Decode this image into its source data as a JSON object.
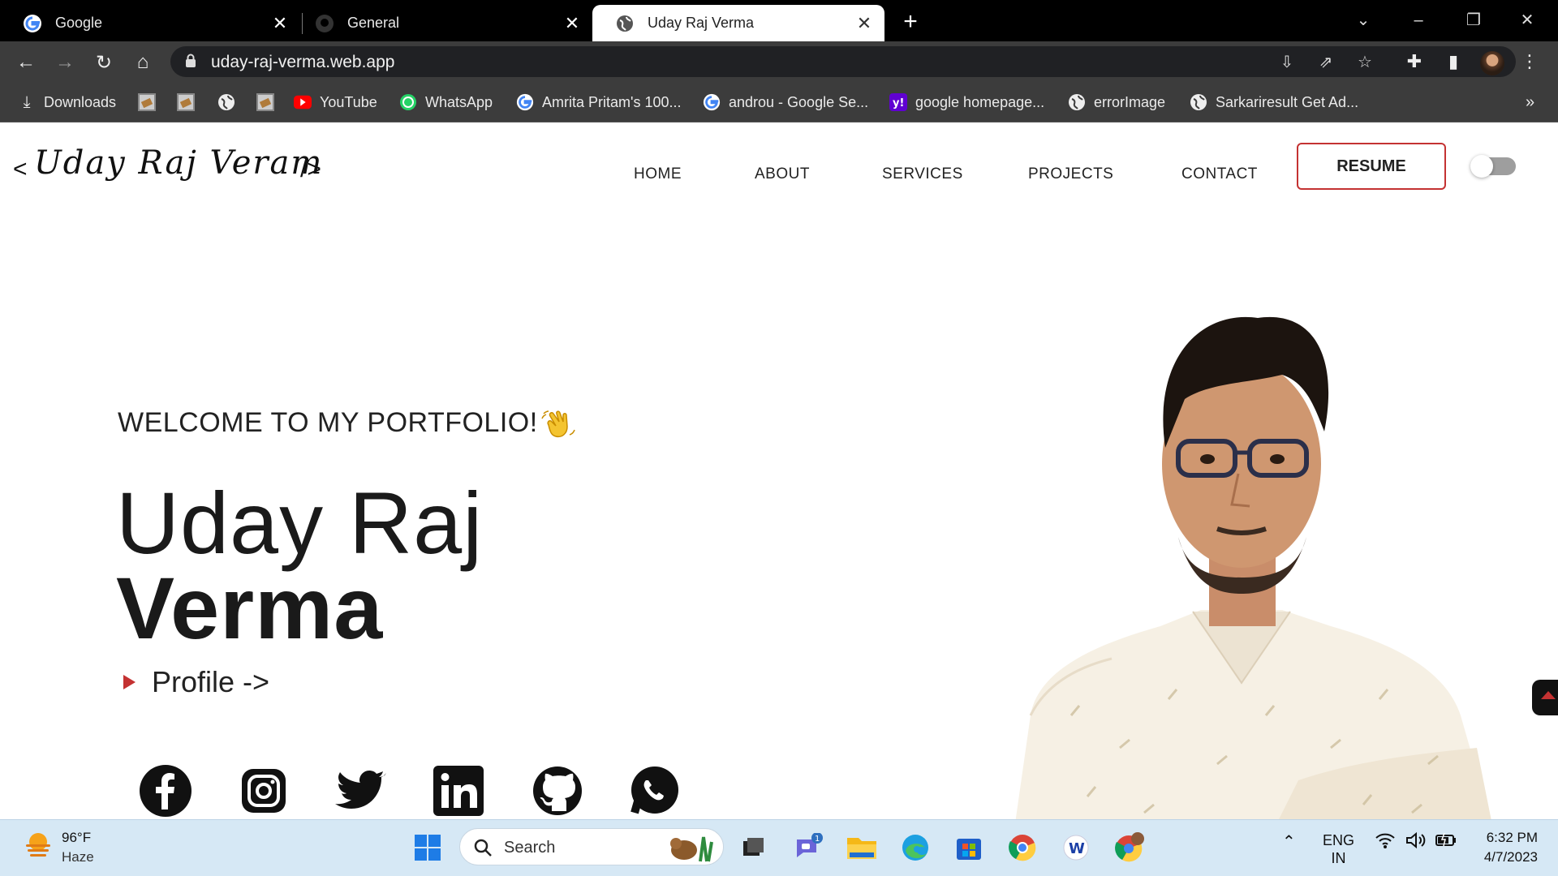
{
  "browser": {
    "tabs": [
      {
        "title": "Google",
        "icon": "google-icon"
      },
      {
        "title": "General",
        "icon": "github-icon"
      },
      {
        "title": "Uday Raj Verma",
        "icon": "globe-icon",
        "active": true
      }
    ],
    "url": "uday-raj-verma.web.app",
    "bookmarks": [
      {
        "label": "Downloads",
        "icon": "download-icon"
      },
      {
        "label": "",
        "icon": "image-icon"
      },
      {
        "label": "",
        "icon": "image-icon"
      },
      {
        "label": "",
        "icon": "globe-icon"
      },
      {
        "label": "",
        "icon": "image-icon"
      },
      {
        "label": "YouTube",
        "icon": "youtube-icon"
      },
      {
        "label": "WhatsApp",
        "icon": "whatsapp-icon"
      },
      {
        "label": "Amrita Pritam's 100...",
        "icon": "google-icon"
      },
      {
        "label": "androu - Google Se...",
        "icon": "google-icon"
      },
      {
        "label": "google homepage...",
        "icon": "yahoo-icon"
      },
      {
        "label": "errorImage",
        "icon": "globe-icon"
      },
      {
        "label": "Sarkariresult Get Ad...",
        "icon": "globe-icon"
      }
    ],
    "overflow": "»"
  },
  "site": {
    "logo_text": "Uday Raj Veram",
    "logo_left": "<",
    "logo_right": "/>",
    "nav": [
      "HOME",
      "ABOUT",
      "SERVICES",
      "PROJECTS",
      "CONTACT"
    ],
    "resume_label": "RESUME",
    "welcome": "WELCOME TO MY PORTFOLIO!",
    "first_name": "Uday Raj",
    "last_name": "Verma",
    "profile_link": "Profile ->",
    "socials": [
      "facebook-icon",
      "instagram-icon",
      "twitter-icon",
      "linkedin-icon",
      "github-icon",
      "whatsapp-icon"
    ],
    "accent_color": "#c43232"
  },
  "taskbar": {
    "weather_temp": "96°F",
    "weather_cond": "Haze",
    "search_placeholder": "Search",
    "chat_badge": "1",
    "lang_top": "ENG",
    "lang_bottom": "IN",
    "time": "6:32 PM",
    "date": "4/7/2023"
  }
}
